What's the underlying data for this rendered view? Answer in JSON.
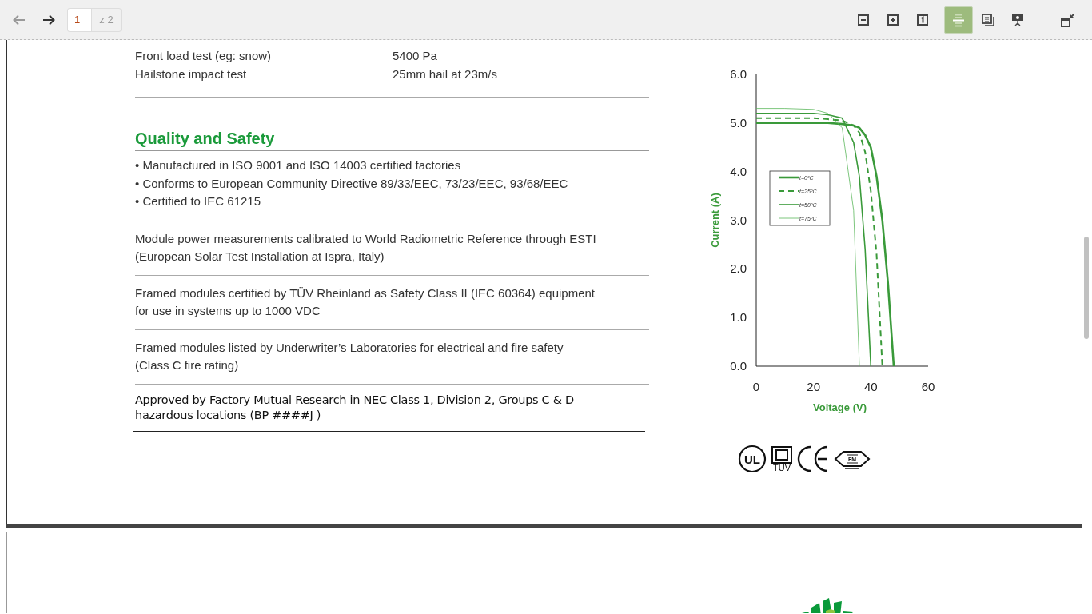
{
  "toolbar": {
    "nav": [
      {
        "kind": "back",
        "disabled": true
      },
      {
        "kind": "forward",
        "disabled": false
      }
    ],
    "page_value": "1",
    "page_total": "z 2",
    "zoom_tools": [
      {
        "kind": "zoom-out"
      },
      {
        "kind": "zoom-in"
      },
      {
        "kind": "actual-size"
      }
    ],
    "view_modes": [
      {
        "kind": "continuous",
        "selected": true
      },
      {
        "kind": "two-page",
        "selected": false
      },
      {
        "kind": "presentation",
        "selected": false
      }
    ],
    "window_tools": [
      {
        "kind": "exit-fullscreen"
      }
    ]
  },
  "document": {
    "test_rows": [
      {
        "label": "Front load test (eg: snow)",
        "value": "5400 Pa"
      },
      {
        "label": "Hailstone impact test",
        "value": "25mm hail at 23m/s"
      }
    ],
    "heading": "Quality and Safety",
    "bullets": [
      "• Manufactured in ISO 9001 and ISO 14003 certified factories",
      "• Conforms to European Community Directive 89/33/EEC, 73/23/EEC, 93/68/EEC",
      "• Certified to IEC 61215"
    ],
    "paragraphs": [
      {
        "kind": "plain",
        "lines": [
          "Module power measurements calibrated to World Radiometric Reference through ESTI",
          "(European Solar Test Installation at Ispra, Italy)"
        ]
      },
      {
        "kind": "plain",
        "lines": [
          "Framed modules certified by TÜV Rheinland as Safety Class II (IEC 60364) equipment",
          "for use in systems up to 1000 VDC"
        ]
      },
      {
        "kind": "plain",
        "lines": [
          "Framed modules listed by Underwriter’s Laboratories for electrical and fire safety",
          "(Class C fire rating)"
        ]
      },
      {
        "kind": "emphasis",
        "lines": [
          "Approved by Factory Mutual Research in NEC Class 1, Division 2, Groups C & D",
          "hazardous locations (BP ####J )"
        ]
      }
    ],
    "chart_data": {
      "type": "line",
      "xlabel": "Voltage (V)",
      "ylabel": "Current (A)",
      "x": [
        0,
        10,
        20,
        25,
        30,
        34,
        36,
        38,
        40,
        42,
        44,
        46,
        48
      ],
      "series": [
        {
          "name": "t=0ºC",
          "color": "#3a9a3a",
          "line_style": "solid",
          "values": [
            5.0,
            5.0,
            5.0,
            5.0,
            4.98,
            4.95,
            4.9,
            4.75,
            4.5,
            3.9,
            3.0,
            1.7,
            0.0
          ]
        },
        {
          "name": "t=25ºC",
          "color": "#3a9a3a",
          "line_style": "dashed",
          "values": [
            5.1,
            5.1,
            5.1,
            5.08,
            5.05,
            4.95,
            4.8,
            4.4,
            3.6,
            2.3,
            0.0,
            null,
            null
          ]
        },
        {
          "name": "t=50ºC",
          "color": "#3a9a3a",
          "line_style": "solid",
          "values": [
            5.2,
            5.2,
            5.2,
            5.17,
            5.1,
            4.6,
            3.9,
            2.4,
            0.0,
            null,
            null,
            null,
            null
          ]
        },
        {
          "name": "t=75ºC",
          "color": "#5cb85c",
          "line_style": "solid",
          "values": [
            5.3,
            5.3,
            5.28,
            5.2,
            4.9,
            3.2,
            0.0,
            null,
            null,
            null,
            null,
            null,
            null
          ]
        }
      ],
      "legend": true,
      "xlim": [
        0,
        60
      ],
      "ylim": [
        0,
        6
      ],
      "xticks": [
        0,
        20,
        40,
        60
      ],
      "yticks": [
        {
          "value": 0,
          "label": "0.0"
        },
        {
          "value": 1,
          "label": "1.0"
        },
        {
          "value": 2,
          "label": "2.0"
        },
        {
          "value": 3,
          "label": "3.0"
        },
        {
          "value": 4,
          "label": "4.0"
        },
        {
          "value": 5,
          "label": "5.0"
        },
        {
          "value": 6,
          "label": "6.0"
        }
      ]
    },
    "certifications": [
      {
        "kind": "ul",
        "text": "UL"
      },
      {
        "kind": "tuv",
        "text": "TÜV"
      },
      {
        "kind": "ce"
      },
      {
        "kind": "fm",
        "text": "FM"
      }
    ]
  }
}
